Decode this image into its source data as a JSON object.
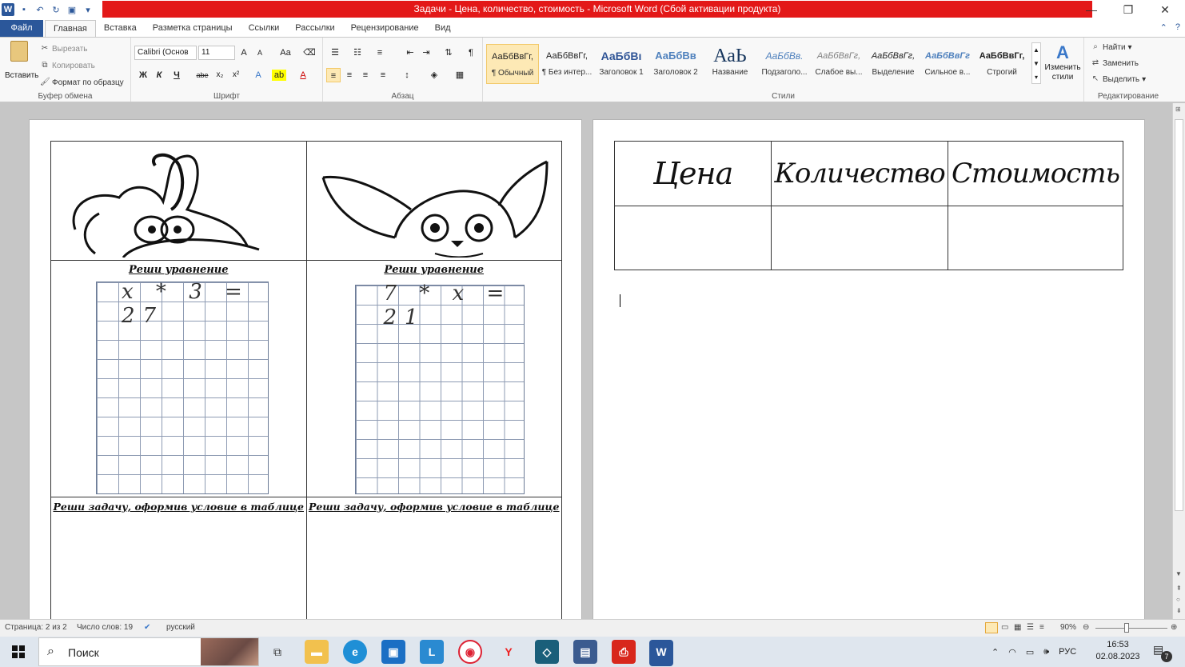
{
  "window": {
    "title": "Задачи - Цена, количество, стоимость  -  Microsoft Word (Сбой активации продукта)"
  },
  "ribbon_tabs": [
    "Файл",
    "Главная",
    "Вставка",
    "Разметка страницы",
    "Ссылки",
    "Рассылки",
    "Рецензирование",
    "Вид"
  ],
  "clipboard": {
    "paste": "Вставить",
    "cut": "Вырезать",
    "copy": "Копировать",
    "format_painter": "Формат по образцу",
    "label": "Буфер обмена"
  },
  "font": {
    "name": "Calibri (Основ",
    "size": "11",
    "label": "Шрифт",
    "bold": "Ж",
    "italic": "К",
    "underline": "Ч",
    "strike": "abe",
    "sub": "x₂",
    "sup": "x²",
    "grow": "A",
    "shrink": "A",
    "case": "Aa"
  },
  "paragraph": {
    "label": "Абзац",
    "pilcrow": "¶"
  },
  "styles": {
    "label": "Стили",
    "items": [
      {
        "sample": "АаБбВвГг,",
        "name": "¶ Обычный"
      },
      {
        "sample": "АаБбВвГг,",
        "name": "¶ Без интер..."
      },
      {
        "sample": "АаБбВı",
        "name": "Заголовок 1"
      },
      {
        "sample": "АаБбВв",
        "name": "Заголовок 2"
      },
      {
        "sample": "АаЬ",
        "name": "Название"
      },
      {
        "sample": "АаБбВв.",
        "name": "Подзаголо..."
      },
      {
        "sample": "АаБбВвГг,",
        "name": "Слабое вы..."
      },
      {
        "sample": "АаБбВвГг,",
        "name": "Выделение"
      },
      {
        "sample": "АаБбВвГг",
        "name": "Сильное в..."
      },
      {
        "sample": "АаБбВвГг,",
        "name": "Строгий"
      }
    ],
    "change_styles": "Изменить стили"
  },
  "editing": {
    "label": "Редактирование",
    "find": "Найти",
    "replace": "Заменить",
    "select": "Выделить"
  },
  "page1": {
    "task_eq": "Реши уравнение",
    "eq_left": "x * 3 = 27",
    "eq_right": "7 * x = 21",
    "task_problem": "Реши задачу, оформив условие в таблице"
  },
  "page2": {
    "headers": [
      "Цена",
      "Количество",
      "Стоимость"
    ]
  },
  "status": {
    "page": "Страница: 2 из 2",
    "words": "Число слов: 19",
    "lang": "русский",
    "zoom": "90%"
  },
  "taskbar": {
    "search_placeholder": "Поиск",
    "lang": "РУС",
    "time": "16:53",
    "date": "02.08.2023",
    "notif_count": "7"
  }
}
